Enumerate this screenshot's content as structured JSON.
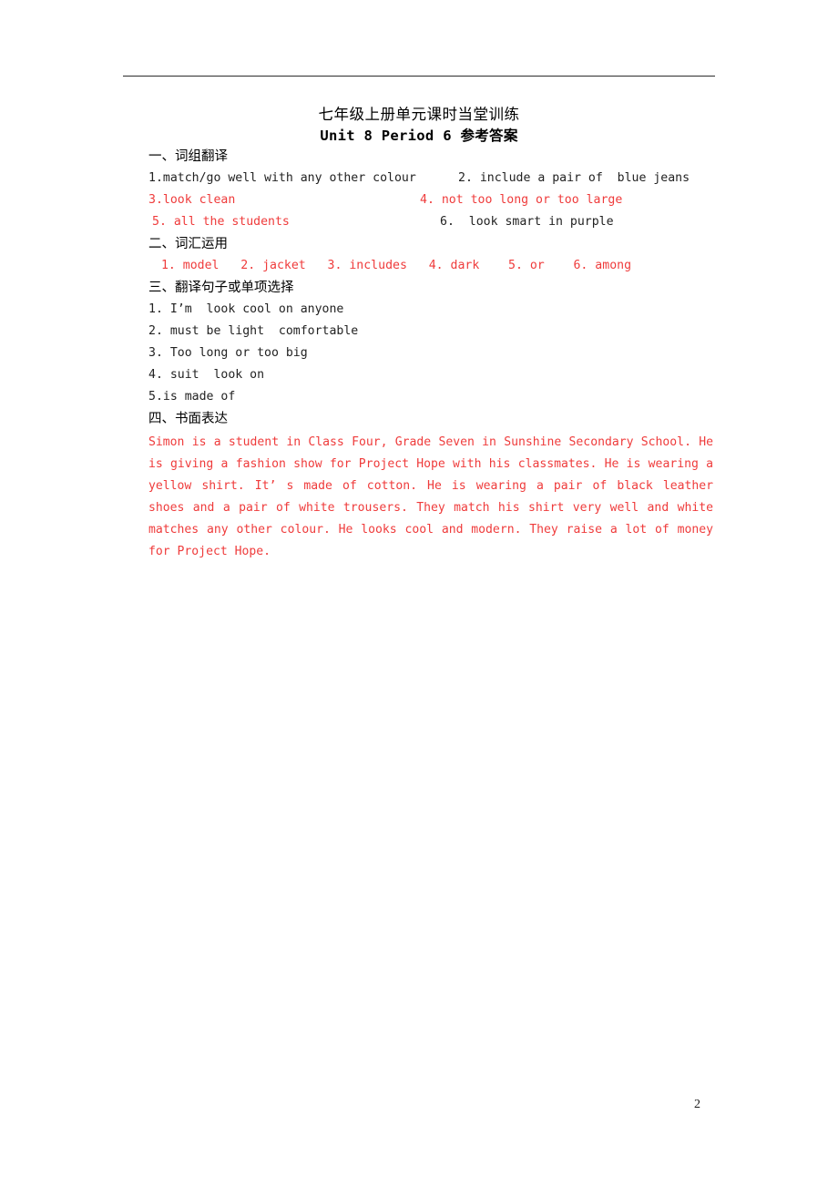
{
  "document": {
    "title_cn": "七年级上册单元课时当堂训练",
    "title_en": "Unit 8 Period 6 ",
    "title_en_cn": "参考答案",
    "page_number": "2",
    "colors": {
      "answer_red": "#ef3b3b",
      "body_black": "#222222",
      "rule": "#2b2b2b"
    }
  },
  "sections": {
    "one": {
      "heading": "一、词组翻译",
      "items": [
        {
          "left": "1.match/go well with any other colour",
          "left_color": "black",
          "right": "2. include a pair of  blue jeans",
          "right_color": "black"
        },
        {
          "left": "3.look clean",
          "left_color": "red",
          "right": "4. not too long or too large",
          "right_color": "red"
        },
        {
          "left": "5. all the students",
          "left_color": "red",
          "right": "6.  look smart in purple",
          "right_color": "black"
        }
      ]
    },
    "two": {
      "heading": "二、词汇运用",
      "answers": " 1. model   2. jacket   3. includes   4. dark    5. or    6. among"
    },
    "three": {
      "heading": "三、翻译句子或单项选择",
      "items": [
        "1. I’m  look cool on anyone",
        "2. must be light  comfortable",
        "3. Too long or too big",
        "4. suit  look on",
        "5.is made of"
      ]
    },
    "four": {
      "heading": "四、书面表达",
      "essay": "Simon is a student in Class Four, Grade Seven in Sunshine Secondary School. He is giving a fashion show for Project Hope with his classmates. He is wearing a yellow shirt. It’ s made of cotton. He is wearing a pair of black leather shoes and a pair of white trousers. They match his shirt very well and white matches any other colour. He looks cool and modern. They raise a lot of money for Project Hope."
    }
  }
}
